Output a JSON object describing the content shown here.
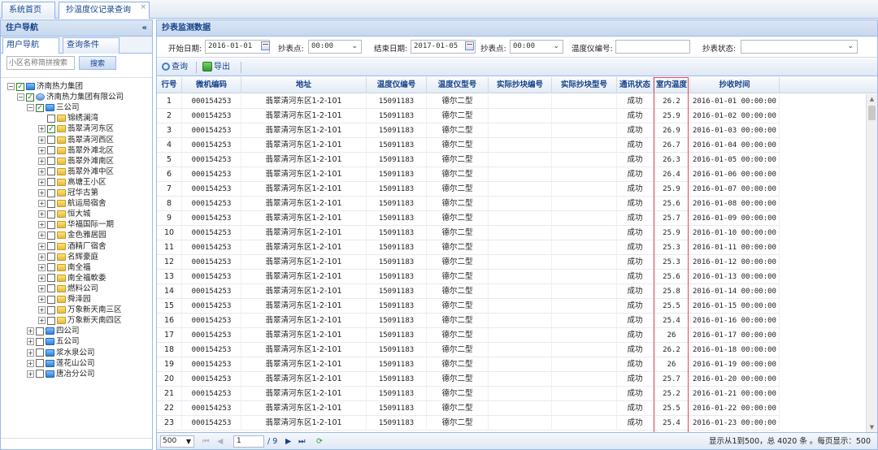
{
  "top_tabs": [
    {
      "label": "系统首页"
    },
    {
      "label": "抄温度仪记录查询",
      "close": "×"
    }
  ],
  "left": {
    "title": "住户导航",
    "collapse": "«",
    "tabs": [
      {
        "label": "用户导航"
      },
      {
        "label": "查询条件"
      }
    ],
    "search_placeholder": "小区名称简拼搜索",
    "search_button": "搜索",
    "tree": [
      {
        "label": "济南热力集团",
        "level": 0,
        "exp": "−",
        "check": true,
        "icon": "folder-blue"
      },
      {
        "label": "济南热力集团有限公司",
        "level": 1,
        "exp": "−",
        "check": true,
        "icon": "org"
      },
      {
        "label": "三公司",
        "level": 2,
        "exp": "−",
        "check": true,
        "icon": "folder-blue"
      },
      {
        "label": "锦绣澜湾",
        "level": 3,
        "exp": "",
        "check": false,
        "icon": "folder"
      },
      {
        "label": "翡翠清河东区",
        "level": 3,
        "exp": "+",
        "check": true,
        "icon": "folder"
      },
      {
        "label": "翡翠清河西区",
        "level": 3,
        "exp": "+",
        "check": false,
        "icon": "folder"
      },
      {
        "label": "翡翠外滩北区",
        "level": 3,
        "exp": "+",
        "check": false,
        "icon": "folder"
      },
      {
        "label": "翡翠外滩南区",
        "level": 3,
        "exp": "+",
        "check": false,
        "icon": "folder"
      },
      {
        "label": "翡翠外滩中区",
        "level": 3,
        "exp": "+",
        "check": false,
        "icon": "folder"
      },
      {
        "label": "高塘王小区",
        "level": 3,
        "exp": "+",
        "check": false,
        "icon": "folder"
      },
      {
        "label": "冠华古第",
        "level": 3,
        "exp": "+",
        "check": false,
        "icon": "folder"
      },
      {
        "label": "航运局宿舍",
        "level": 3,
        "exp": "+",
        "check": false,
        "icon": "folder"
      },
      {
        "label": "恒大城",
        "level": 3,
        "exp": "+",
        "check": false,
        "icon": "folder"
      },
      {
        "label": "华福国际一期",
        "level": 3,
        "exp": "+",
        "check": false,
        "icon": "folder"
      },
      {
        "label": "金色雅居园",
        "level": 3,
        "exp": "+",
        "check": false,
        "icon": "folder"
      },
      {
        "label": "酒精厂宿舍",
        "level": 3,
        "exp": "+",
        "check": false,
        "icon": "folder"
      },
      {
        "label": "名辉豪庭",
        "level": 3,
        "exp": "+",
        "check": false,
        "icon": "folder"
      },
      {
        "label": "南全福",
        "level": 3,
        "exp": "+",
        "check": false,
        "icon": "folder"
      },
      {
        "label": "南全福軟委",
        "level": 3,
        "exp": "+",
        "check": false,
        "icon": "folder"
      },
      {
        "label": "燃料公司",
        "level": 3,
        "exp": "+",
        "check": false,
        "icon": "folder"
      },
      {
        "label": "舜泽园",
        "level": 3,
        "exp": "+",
        "check": false,
        "icon": "folder"
      },
      {
        "label": "万象新天南三区",
        "level": 3,
        "exp": "+",
        "check": false,
        "icon": "folder"
      },
      {
        "label": "万象新天南四区",
        "level": 3,
        "exp": "+",
        "check": false,
        "icon": "folder"
      },
      {
        "label": "四公司",
        "level": 2,
        "exp": "+",
        "check": false,
        "icon": "folder-blue"
      },
      {
        "label": "五公司",
        "level": 2,
        "exp": "+",
        "check": false,
        "icon": "folder-blue"
      },
      {
        "label": "浆水泉公司",
        "level": 2,
        "exp": "+",
        "check": false,
        "icon": "folder-blue"
      },
      {
        "label": "莲花山公司",
        "level": 2,
        "exp": "+",
        "check": false,
        "icon": "folder-blue"
      },
      {
        "label": "唐冶分公司",
        "level": 2,
        "exp": "+",
        "check": false,
        "icon": "folder-blue"
      }
    ]
  },
  "right": {
    "title": "抄表监测数据",
    "filter": {
      "start_label": "开始日期:",
      "start_value": "2016-01-01",
      "point1_label": "抄表点:",
      "point1_value": "00:00",
      "end_label": "结束日期:",
      "end_value": "2017-01-05",
      "point2_label": "抄表点:",
      "point2_value": "00:00",
      "meter_label": "温度仪编号:",
      "meter_value": "",
      "status_label": "抄表状态:",
      "status_value": "",
      "arrow": "⌄"
    },
    "toolbar": {
      "query": "查询",
      "export": "导出"
    },
    "columns": [
      "行号",
      "微机编码",
      "地址",
      "温度仪编号",
      "温度仪型号",
      "实际抄块编号",
      "实际抄块型号",
      "通讯状态",
      "室内温度",
      "抄收时间"
    ],
    "rows": [
      [
        "1",
        "000154253",
        "翡翠清河东区1-2-101",
        "15091183",
        "德尔二型",
        "",
        "",
        "成功",
        "26.2",
        "2016-01-01 00:00:00"
      ],
      [
        "2",
        "000154253",
        "翡翠清河东区1-2-101",
        "15091183",
        "德尔二型",
        "",
        "",
        "成功",
        "25.9",
        "2016-01-02 00:00:00"
      ],
      [
        "3",
        "000154253",
        "翡翠清河东区1-2-101",
        "15091183",
        "德尔二型",
        "",
        "",
        "成功",
        "26.9",
        "2016-01-03 00:00:00"
      ],
      [
        "4",
        "000154253",
        "翡翠清河东区1-2-101",
        "15091183",
        "德尔二型",
        "",
        "",
        "成功",
        "26.7",
        "2016-01-04 00:00:00"
      ],
      [
        "5",
        "000154253",
        "翡翠清河东区1-2-101",
        "15091183",
        "德尔二型",
        "",
        "",
        "成功",
        "26.3",
        "2016-01-05 00:00:00"
      ],
      [
        "6",
        "000154253",
        "翡翠清河东区1-2-101",
        "15091183",
        "德尔二型",
        "",
        "",
        "成功",
        "26.4",
        "2016-01-06 00:00:00"
      ],
      [
        "7",
        "000154253",
        "翡翠清河东区1-2-101",
        "15091183",
        "德尔二型",
        "",
        "",
        "成功",
        "25.9",
        "2016-01-07 00:00:00"
      ],
      [
        "8",
        "000154253",
        "翡翠清河东区1-2-101",
        "15091183",
        "德尔二型",
        "",
        "",
        "成功",
        "25.6",
        "2016-01-08 00:00:00"
      ],
      [
        "9",
        "000154253",
        "翡翠清河东区1-2-101",
        "15091183",
        "德尔二型",
        "",
        "",
        "成功",
        "25.7",
        "2016-01-09 00:00:00"
      ],
      [
        "10",
        "000154253",
        "翡翠清河东区1-2-101",
        "15091183",
        "德尔二型",
        "",
        "",
        "成功",
        "25.9",
        "2016-01-10 00:00:00"
      ],
      [
        "11",
        "000154253",
        "翡翠清河东区1-2-101",
        "15091183",
        "德尔二型",
        "",
        "",
        "成功",
        "25.3",
        "2016-01-11 00:00:00"
      ],
      [
        "12",
        "000154253",
        "翡翠清河东区1-2-101",
        "15091183",
        "德尔二型",
        "",
        "",
        "成功",
        "25.3",
        "2016-01-12 00:00:00"
      ],
      [
        "13",
        "000154253",
        "翡翠清河东区1-2-101",
        "15091183",
        "德尔二型",
        "",
        "",
        "成功",
        "25.6",
        "2016-01-13 00:00:00"
      ],
      [
        "14",
        "000154253",
        "翡翠清河东区1-2-101",
        "15091183",
        "德尔二型",
        "",
        "",
        "成功",
        "25.8",
        "2016-01-14 00:00:00"
      ],
      [
        "15",
        "000154253",
        "翡翠清河东区1-2-101",
        "15091183",
        "德尔二型",
        "",
        "",
        "成功",
        "25.5",
        "2016-01-15 00:00:00"
      ],
      [
        "16",
        "000154253",
        "翡翠清河东区1-2-101",
        "15091183",
        "德尔二型",
        "",
        "",
        "成功",
        "25.4",
        "2016-01-16 00:00:00"
      ],
      [
        "17",
        "000154253",
        "翡翠清河东区1-2-101",
        "15091183",
        "德尔二型",
        "",
        "",
        "成功",
        "26",
        "2016-01-17 00:00:00"
      ],
      [
        "18",
        "000154253",
        "翡翠清河东区1-2-101",
        "15091183",
        "德尔二型",
        "",
        "",
        "成功",
        "26.2",
        "2016-01-18 00:00:00"
      ],
      [
        "19",
        "000154253",
        "翡翠清河东区1-2-101",
        "15091183",
        "德尔二型",
        "",
        "",
        "成功",
        "26",
        "2016-01-19 00:00:00"
      ],
      [
        "20",
        "000154253",
        "翡翠清河东区1-2-101",
        "15091183",
        "德尔二型",
        "",
        "",
        "成功",
        "25.7",
        "2016-01-20 00:00:00"
      ],
      [
        "21",
        "000154253",
        "翡翠清河东区1-2-101",
        "15091183",
        "德尔二型",
        "",
        "",
        "成功",
        "25.2",
        "2016-01-21 00:00:00"
      ],
      [
        "22",
        "000154253",
        "翡翠清河东区1-2-101",
        "15091183",
        "德尔二型",
        "",
        "",
        "成功",
        "25.5",
        "2016-01-22 00:00:00"
      ],
      [
        "23",
        "000154253",
        "翡翠清河东区1-2-101",
        "15091183",
        "德尔二型",
        "",
        "",
        "成功",
        "25.4",
        "2016-01-23 00:00:00"
      ]
    ],
    "pager": {
      "page_size": "500",
      "page_value": "1",
      "total_pages": "/ 9",
      "summary": "显示从1到500，总 4020 条 。每页显示：500",
      "first": "⏮",
      "prev": "◀",
      "next": "▶",
      "last": "⏭",
      "refresh": "⟳"
    }
  },
  "colors": {
    "highlight": "#e2495a",
    "header_text": "#15428b",
    "border": "#99bbe8"
  }
}
